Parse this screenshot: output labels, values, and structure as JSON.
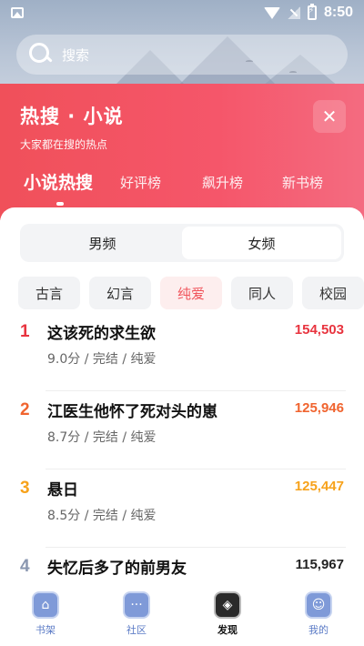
{
  "status_bar": {
    "time": "8:50",
    "icons": [
      "picture-icon",
      "wifi-icon",
      "signal-off-icon",
      "battery-charging-icon"
    ]
  },
  "search": {
    "placeholder": "搜索"
  },
  "header": {
    "title": "热搜 · 小说",
    "subtitle": "大家都在搜的热点",
    "close_icon": "close-icon",
    "tabs": [
      {
        "label": "小说热搜",
        "active": true
      },
      {
        "label": "好评榜",
        "active": false
      },
      {
        "label": "飙升榜",
        "active": false
      },
      {
        "label": "新书榜",
        "active": false
      }
    ]
  },
  "gender": {
    "options": [
      {
        "label": "男频",
        "active": false
      },
      {
        "label": "女频",
        "active": true
      }
    ]
  },
  "categories": [
    {
      "label": "古言",
      "active": false
    },
    {
      "label": "幻言",
      "active": false
    },
    {
      "label": "纯爱",
      "active": true
    },
    {
      "label": "同人",
      "active": false
    },
    {
      "label": "校园",
      "active": false
    }
  ],
  "ranking": [
    {
      "rank": "1",
      "title": "这该死的求生欲",
      "meta": "9.0分 / 完结 / 纯爱",
      "heat": "154,503",
      "color": "#e8343f"
    },
    {
      "rank": "2",
      "title": "江医生他怀了死对头的崽",
      "meta": "8.7分 / 完结 / 纯爱",
      "heat": "125,946",
      "color": "#f0642f"
    },
    {
      "rank": "3",
      "title": "悬日",
      "meta": "8.5分 / 完结 / 纯爱",
      "heat": "125,447",
      "color": "#f7a21b"
    },
    {
      "rank": "4",
      "title": "失忆后多了的前男友",
      "meta": "",
      "heat": "115,967",
      "color": "#8a97b0"
    }
  ],
  "bottom_nav": [
    {
      "label": "书架",
      "icon": "home-icon",
      "active": false
    },
    {
      "label": "社区",
      "icon": "chat-icon",
      "active": false
    },
    {
      "label": "发现",
      "icon": "compass-icon",
      "active": true
    },
    {
      "label": "我的",
      "icon": "user-icon",
      "active": false
    }
  ],
  "colors": {
    "accent_red": "#f0505a",
    "chip_active_bg": "#fdeeee",
    "nav_blue": "#7f9ad8"
  }
}
